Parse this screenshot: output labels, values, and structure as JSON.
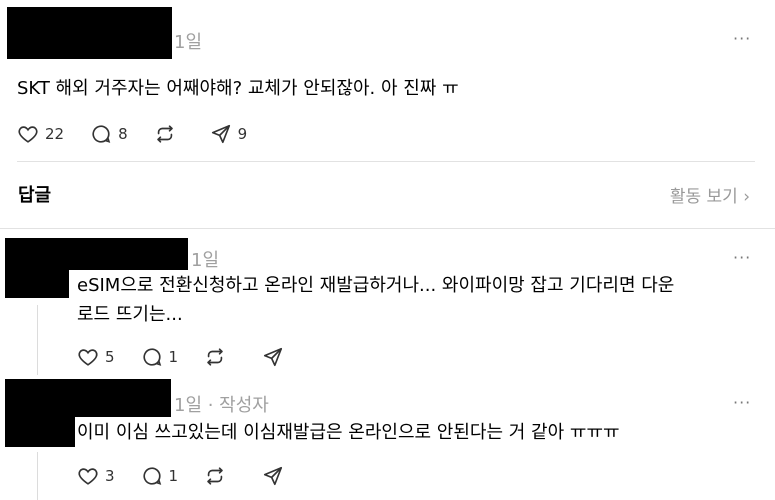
{
  "post": {
    "time": "1일",
    "more": "···",
    "text": "SKT 해외 거주자는 어째야해? 교체가 안되잖아. 아 진짜 ㅠ",
    "likes": "22",
    "comments": "8",
    "shares": "9"
  },
  "replies_header": {
    "title": "답글",
    "view_activity": "활동 보기 ›"
  },
  "replies": [
    {
      "time": "1일",
      "text_line1": "eSIM으로 전환신청하고 온라인 재발급하거나... 와이파이망 잡고 기다리면 다운",
      "text_line2": "로드 뜨기는...",
      "likes": "5",
      "comments": "1",
      "more": "···"
    },
    {
      "time": "1일 · 작성자",
      "text_line1": "이미 이심 쓰고있는데 이심재발급은 온라인으로 안된다는 거 같아 ㅠㅠㅠ",
      "likes": "3",
      "comments": "1",
      "more": "···"
    }
  ],
  "icons": [
    "heart-icon",
    "comment-icon",
    "repost-icon",
    "share-icon",
    "more-icon",
    "chevron-right-icon"
  ]
}
